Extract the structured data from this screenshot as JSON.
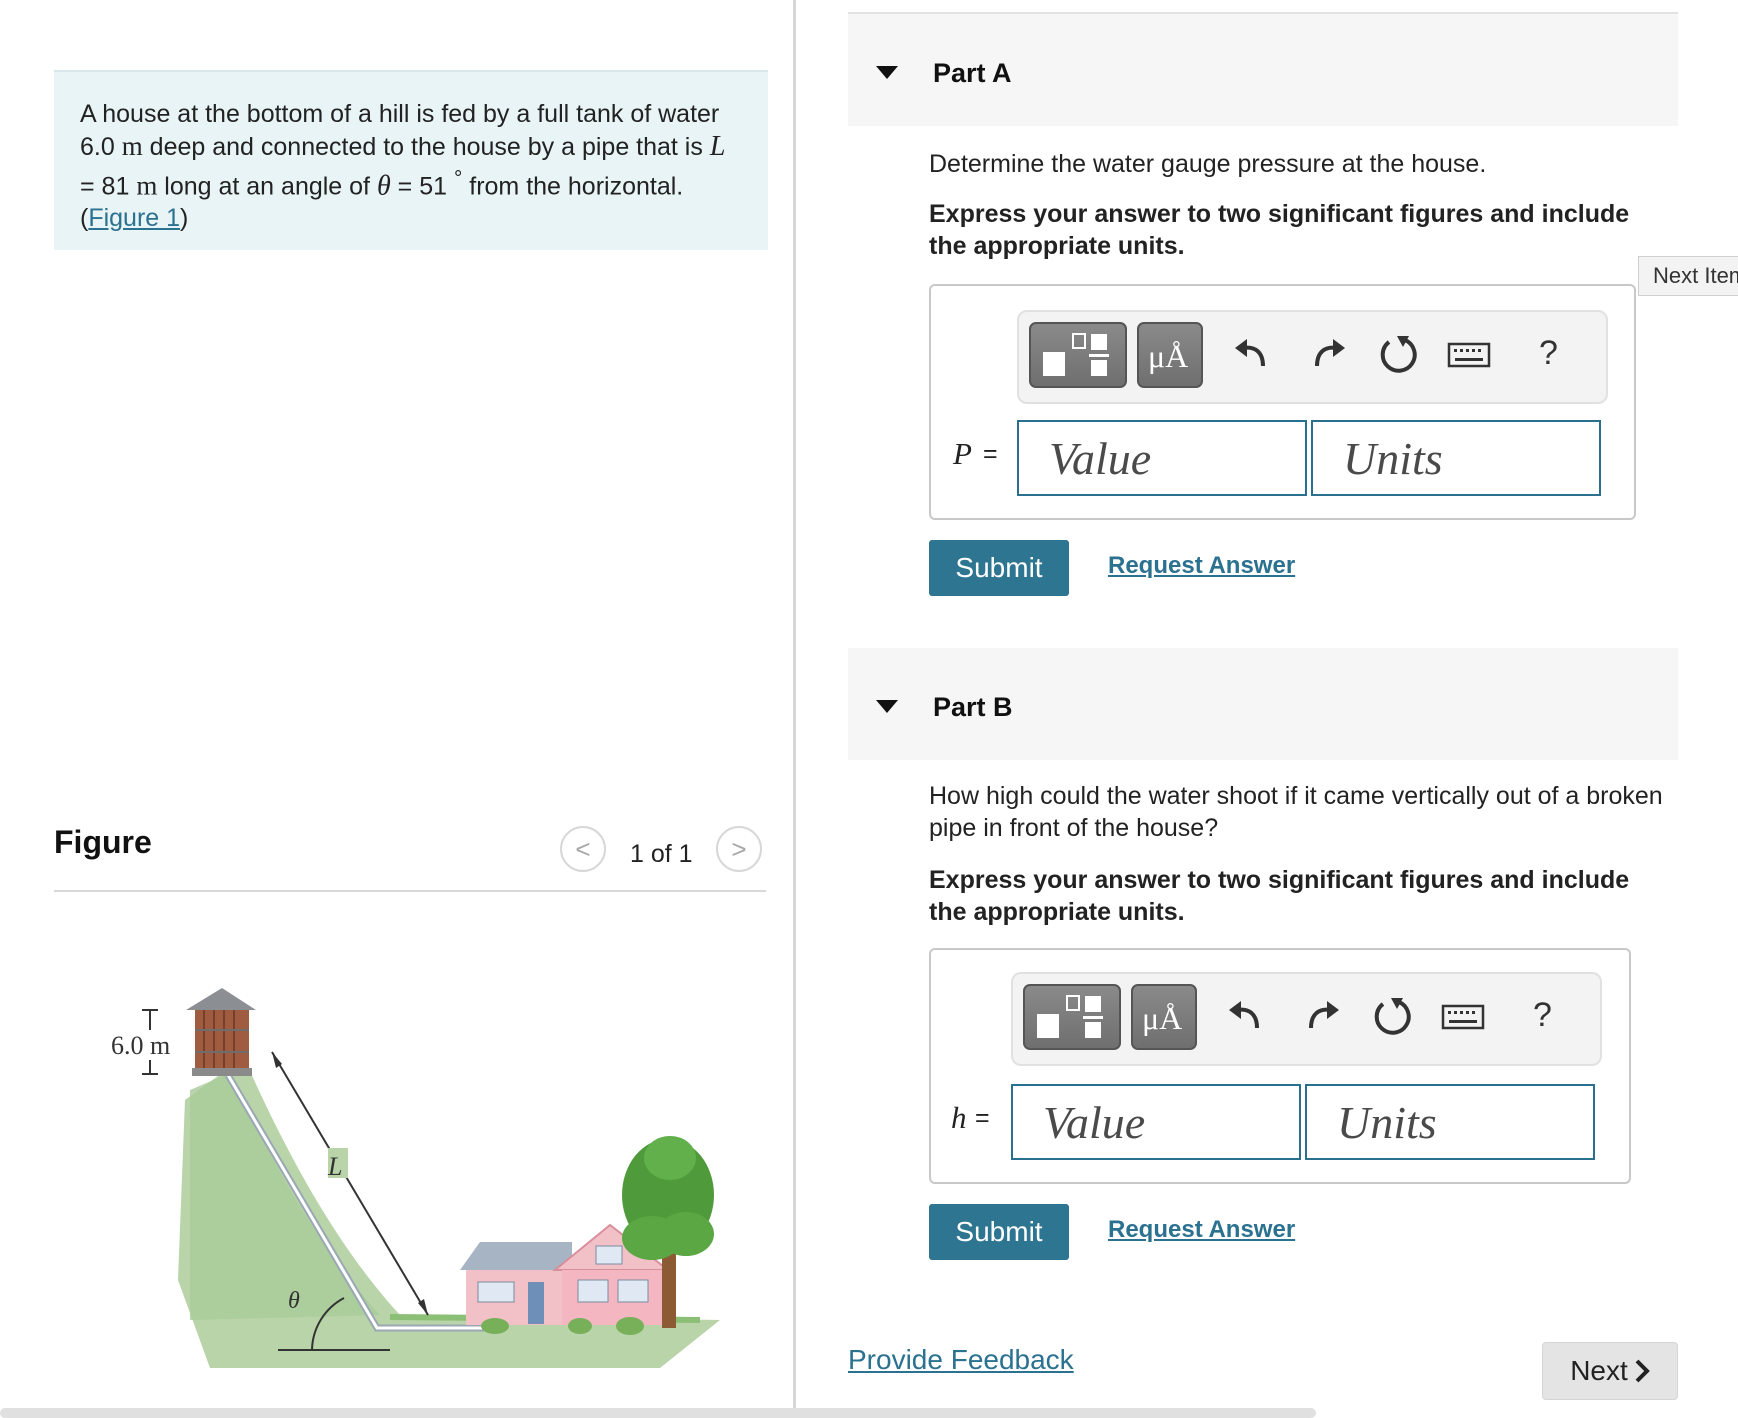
{
  "problem": {
    "text_1": "A house at the bottom of a hill is fed by a full tank of water 6.0 ",
    "unit_m_1": "m",
    "text_2": " deep and connected to the house by a pipe that is ",
    "var_L": "L",
    "text_3": " = 81 ",
    "unit_m_2": "m",
    "text_4": " long at an angle of ",
    "var_theta": "θ",
    "text_5": " = 51 ",
    "degree": "°",
    "text_6": " from the horizontal. (",
    "figure_link": "Figure 1",
    "text_7": ")"
  },
  "figure": {
    "title": "Figure",
    "pager_prev": "<",
    "pager_count": "1 of 1",
    "pager_next": ">",
    "label_height": "6.0 m",
    "label_L": "L",
    "label_theta": "θ"
  },
  "next_item_tab": "Next Item",
  "part_a": {
    "title": "Part A",
    "question": "Determine the water gauge pressure at the house.",
    "instruction": "Express your answer to two significant figures and include the appropriate units.",
    "var": "P",
    "eq": "=",
    "value_placeholder": "Value",
    "units_placeholder": "Units",
    "submit": "Submit",
    "request": "Request Answer"
  },
  "part_b": {
    "title": "Part B",
    "question": "How high could the water shoot if it came vertically out of a broken pipe in front of the house?",
    "instruction": "Express your answer to two significant figures and include the appropriate units.",
    "var": "h",
    "eq": "=",
    "value_placeholder": "Value",
    "units_placeholder": "Units",
    "submit": "Submit",
    "request": "Request Answer"
  },
  "toolbar": {
    "units_button": "μÅ",
    "help": "?"
  },
  "footer": {
    "feedback": "Provide Feedback",
    "next": "Next"
  },
  "colors": {
    "accent": "#2e7592",
    "link": "#2b7190",
    "problem_bg": "#e8f4f6"
  }
}
